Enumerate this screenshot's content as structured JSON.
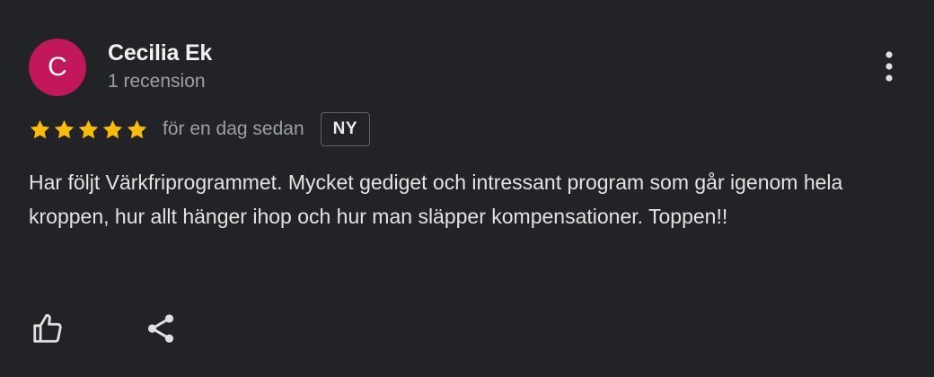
{
  "review": {
    "author": {
      "initial": "C",
      "name": "Cecilia Ek",
      "review_count": "1 recension",
      "avatar_color": "#c2185b"
    },
    "rating": 5,
    "max_rating": 5,
    "star_color": "#fbbc04",
    "date": "för en dag sedan",
    "badge": "NY",
    "text": "Har följt Värkfriprogrammet. Mycket gediget och intressant program som går igenom hela kroppen, hur allt hänger ihop och hur man släpper kompensationer. Toppen!!"
  },
  "icons": {
    "more": "more-vertical-icon",
    "like": "thumbs-up-icon",
    "share": "share-icon"
  }
}
